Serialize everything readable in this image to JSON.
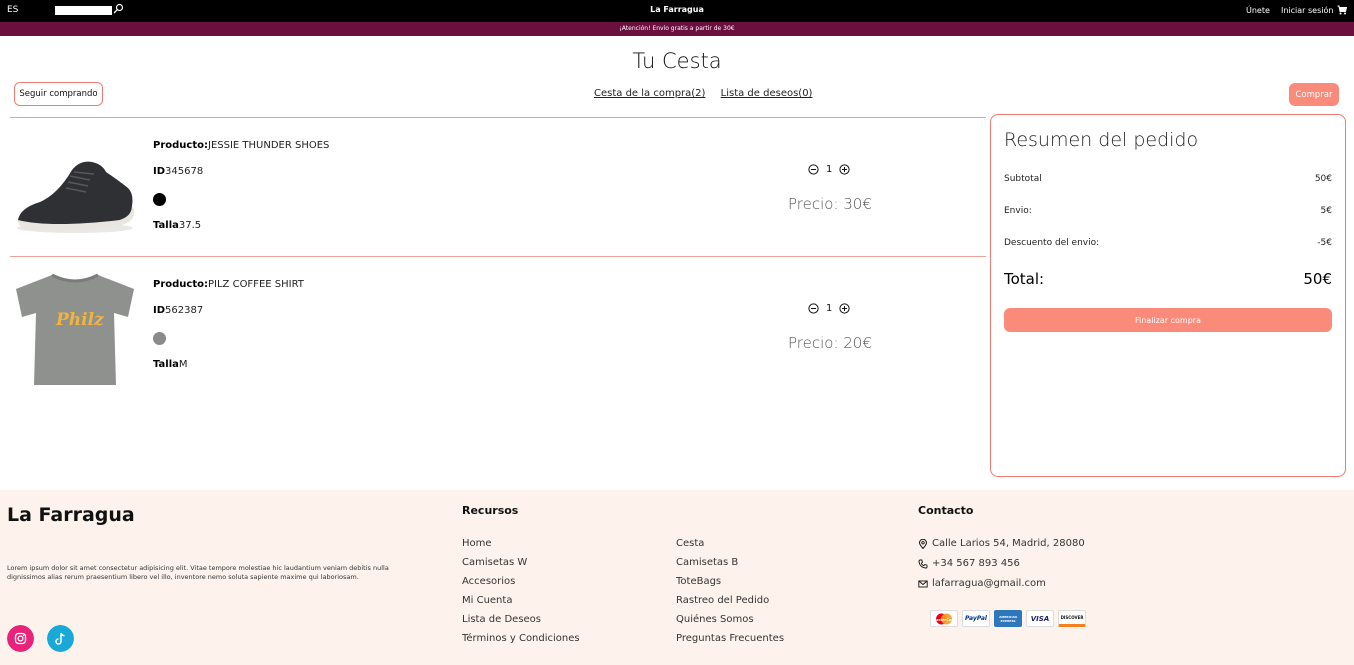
{
  "topbar": {
    "lang": "ES",
    "brand": "La Farragua",
    "join": "Únete",
    "login": "Iniciar sesión"
  },
  "announcement": "¡Atención! Envío gratis a partir de 30€",
  "page_title": "Tu Cesta",
  "actions": {
    "continue": "Seguir comprando",
    "buy": "Comprar",
    "tab_cart": "Cesta de la compra(2)",
    "tab_wishlist": "Lista de deseos(0)"
  },
  "products": [
    {
      "product_label": "Producto:",
      "product_value": "JESSIE THUNDER SHOES",
      "id_label": "ID",
      "id_value": "345678",
      "color": "#000000",
      "size_label": "Talla",
      "size_value": "37.5",
      "qty": "1",
      "price": "Precio: 30€"
    },
    {
      "product_label": "Producto:",
      "product_value": "PILZ COFFEE SHIRT",
      "id_label": "ID",
      "id_value": "562387",
      "color": "#8a8a8a",
      "size_label": "Talla",
      "size_value": "M",
      "qty": "1",
      "price": "Precio: 20€"
    }
  ],
  "summary": {
    "title": "Resumen del pedido",
    "subtotal_label": "Subtotal",
    "subtotal_value": "50€",
    "shipping_label": "Envio:",
    "shipping_value": "5€",
    "discount_label": "Descuento del envio:",
    "discount_value": "-5€",
    "total_label": "Total:",
    "total_value": "50€",
    "finish": "Finalizar compra"
  },
  "footer": {
    "brand": "La Farragua",
    "lorem": "Lorem ipsum dolor sit amet consectetur adipisicing elit. Vitae tempore molestiae hic laudantium veniam debitis nulla dignissimos alias rerum praesentium libero vel illo, inventore nemo soluta sapiente maxime qui laboriosam.",
    "resources_title": "Recursos",
    "col1": [
      "Home",
      "Camisetas W",
      "Accesorios",
      "Mi Cuenta",
      "Lista de Deseos",
      "Términos y Condiciones"
    ],
    "col2": [
      "Cesta",
      "Camisetas B",
      "ToteBags",
      "Rastreo del Pedido",
      "Quiénes Somos",
      "Preguntas Frecuentes"
    ],
    "contact_title": "Contacto",
    "address": "Calle Larios 54, Madrid, 28080",
    "phone": "+34 567 893 456",
    "email": "lafarragua@gmail.com",
    "payments": [
      "MasterCard",
      "PayPal",
      "AMERICAN EXPRESS",
      "VISA",
      "DISCOVER"
    ]
  },
  "colors": {
    "accent": "#fa8a79",
    "announce_bg": "#6a0f3e",
    "footer_bg": "#fdf3ec",
    "instagram": "#e8247a",
    "tiktok": "#1aa9d6"
  }
}
